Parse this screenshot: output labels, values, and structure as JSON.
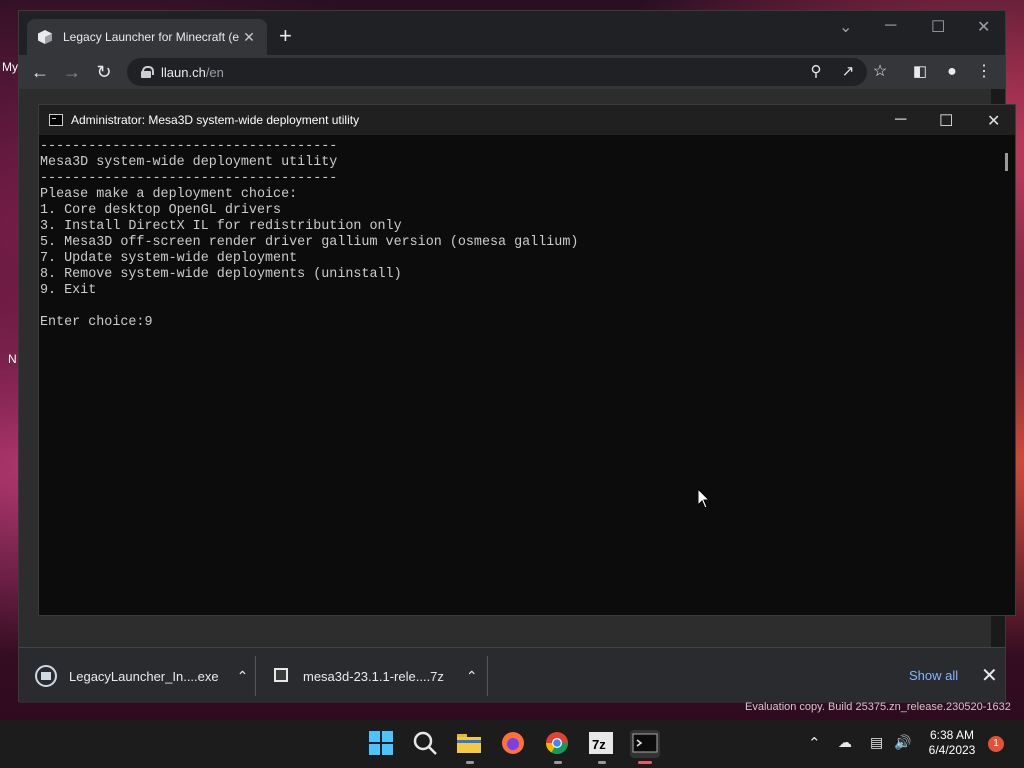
{
  "desktop": {
    "fragment_my": "My",
    "fragment_n": "N"
  },
  "browser": {
    "tab_title": "Legacy Launcher for Minecraft (e",
    "tab_close": "✕",
    "new_tab": "+",
    "url_host": "llaun.ch",
    "url_path": "/en",
    "window_controls": {
      "chevron": "⌄",
      "minimize": "─",
      "maximize": "☐",
      "close": "✕"
    }
  },
  "console": {
    "title": "Administrator:  Mesa3D system-wide deployment utility",
    "controls": {
      "minimize": "─",
      "maximize": "☐",
      "close": "✕"
    },
    "lines": [
      "-------------------------------------",
      "Mesa3D system-wide deployment utility",
      "-------------------------------------",
      "Please make a deployment choice:",
      "1. Core desktop OpenGL drivers",
      "3. Install DirectX IL for redistribution only",
      "5. Mesa3D off-screen render driver gallium version (osmesa gallium)",
      "7. Update system-wide deployment",
      "8. Remove system-wide deployments (uninstall)",
      "9. Exit",
      "",
      "Enter choice:9"
    ]
  },
  "downloads": {
    "items": [
      {
        "name": "LegacyLauncher_In....exe"
      },
      {
        "name": "mesa3d-23.1.1-rele....7z"
      }
    ],
    "show_all": "Show all",
    "close": "✕"
  },
  "watermark": "Evaluation copy. Build 25375.zn_release.230520-1632",
  "taskbar": {
    "time": "6:38 AM",
    "date": "6/4/2023",
    "notification_count": "1"
  }
}
